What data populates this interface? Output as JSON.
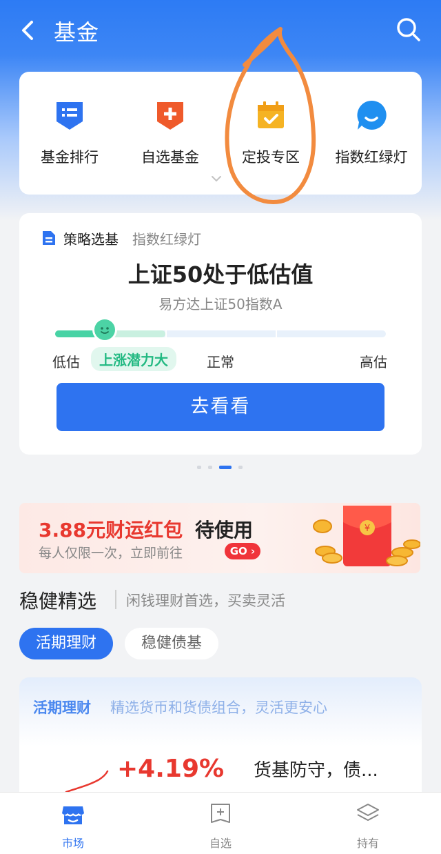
{
  "colors": {
    "accent": "#2e73f0",
    "header": "#2d7bf4",
    "red": "#e8382f",
    "green": "#48d3a5",
    "annotation": "#f28b3f"
  },
  "header": {
    "title": "基金",
    "back_icon": "chevron-left-icon",
    "search_icon": "search-icon"
  },
  "quick_menu": {
    "items": [
      {
        "label": "基金排行",
        "icon": "list-icon"
      },
      {
        "label": "自选基金",
        "icon": "plus-bookmark-icon"
      },
      {
        "label": "定投专区",
        "icon": "calendar-check-icon"
      },
      {
        "label": "指数红绿灯",
        "icon": "chat-bubble-icon"
      }
    ],
    "expand_icon": "chevron-down-icon"
  },
  "strategy": {
    "title": "策略选基",
    "subtitle": "指数红绿灯",
    "headline": "上证50处于低估值",
    "fund": "易方达上证50指数A",
    "levels": [
      "低估",
      "上涨潜力大",
      "正常",
      "高估"
    ],
    "active_level": "上涨潜力大",
    "position": 0.15,
    "cta": "去看看"
  },
  "carousel": {
    "count": 4,
    "active": 2
  },
  "banner": {
    "amount": "3.88元财运红包",
    "suffix": "待使用",
    "subtitle": "每人仅限一次，立即前往",
    "go_label": "GO"
  },
  "section": {
    "title": "稳健精选",
    "subtitle": "闲钱理财首选，买卖灵活",
    "tabs": [
      {
        "label": "活期理财",
        "active": true
      },
      {
        "label": "稳健债基",
        "active": false
      }
    ]
  },
  "product": {
    "tag": "活期理财",
    "description": "精选货币和货债组合，灵活更安心",
    "rate": "+4.19%",
    "name": "货基防守，债..."
  },
  "tabbar": {
    "items": [
      {
        "label": "市场",
        "icon": "store-icon",
        "active": true
      },
      {
        "label": "自选",
        "icon": "add-watchlist-icon",
        "active": false
      },
      {
        "label": "持有",
        "icon": "layers-icon",
        "active": false
      }
    ]
  }
}
